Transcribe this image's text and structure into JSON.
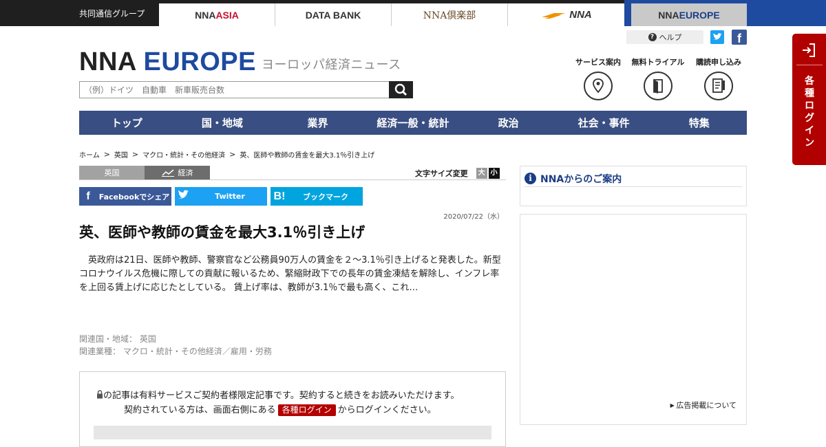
{
  "topbar": {
    "group": "共同通信グループ",
    "tabs": {
      "asia_prefix": "NNA ",
      "asia_suffix": "ASIA",
      "databank": "DATA BANK",
      "club": "NNA倶楽部",
      "nna": "NNA",
      "europe_prefix": "NNA ",
      "europe_suffix": "EUROPE"
    }
  },
  "header": {
    "help": "ヘルプ",
    "logo_nna": "NNA ",
    "logo_europe": "EUROPE",
    "subtitle": "ヨーロッパ経済ニュース",
    "search_placeholder": "（例）ドイツ　自動車　新車販売台数",
    "services": [
      "サービス案内",
      "無料トライアル",
      "購読申し込み"
    ]
  },
  "nav": [
    "トップ",
    "国・地域",
    "業界",
    "経済一般・統計",
    "政治",
    "社会・事件",
    "特集"
  ],
  "breadcrumb": [
    "ホーム",
    "英国",
    "マクロ・統計・その他経済",
    "英、医師や教師の賃金を最大3.1％引き上げ"
  ],
  "tags": {
    "country": "英国",
    "category": "経済"
  },
  "font_size": {
    "label": "文字サイズ変更",
    "large": "大",
    "small": "小"
  },
  "share": {
    "facebook": "Facebookでシェア",
    "twitter": "Twitter",
    "hatena": "ブックマーク"
  },
  "article": {
    "date": "2020/07/22（水）",
    "title": "英、医師や教師の賃金を最大3.1％引き上げ",
    "body": "英政府は21日、医師や教師、警察官など公務員90万人の賃金を２～3.1％引き上げると発表した。新型コロナウイルス危機に際しての貢献に報いるため、緊縮財政下での長年の賃金凍結を解除し、インフレ率を上回る賃上げに応じたとしている。 賃上げ率は、教師が3.1％で最も高く、これ…",
    "related_country": "関連国・地域：  英国",
    "related_industry": "関連業種：  マクロ・統計・その他経済／雇用・労務"
  },
  "paywall": {
    "line1": "の記事は有料サービスご契約者様限定記事です。契約すると続きをお読みいただけます。",
    "line2_pre": "契約されている方は、画面右側にある",
    "line2_badge": "各種ログイン",
    "line2_post": "からログインください。"
  },
  "sidebar": {
    "info_title": "NNAからのご案内",
    "ad_link": "広告掲載について"
  },
  "login_tab": {
    "label": "各種ログイン"
  },
  "colors": {
    "nav": "#394e82",
    "brand_blue": "#1e4aa0",
    "login_red": "#b00000"
  }
}
